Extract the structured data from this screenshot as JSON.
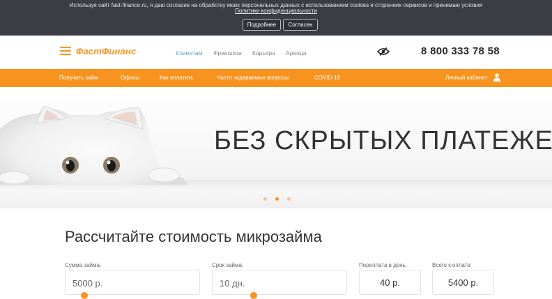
{
  "cookie": {
    "text": "Используя сайт fast-finance.ru, я даю согласие на обработку моих персональных данных с использованием cookies и сторонних сервисов и принимаю условия",
    "link": "Политики конфиденциальности",
    "more_label": "Подробнее",
    "agree_label": "Согласен"
  },
  "header": {
    "logo": "ФастФинанс",
    "nav": [
      "Клиентам",
      "Франшиза",
      "Карьера",
      "Аренда"
    ],
    "phone": "8 800 333 78 58"
  },
  "menu": {
    "items": [
      "Получить займ",
      "Офисы",
      "Как оплатить",
      "Часто задаваемые вопросы",
      "COVID-19"
    ],
    "cabinet": "Личный кабинет"
  },
  "banner": {
    "headline": "БЕЗ СКРЫТЫХ ПЛАТЕЖЕЙ",
    "slides_total": 3,
    "active_slide": 2
  },
  "calculator": {
    "title": "Рассчитайте стоимость микрозайма",
    "amount_label": "Сумма займа:",
    "amount_value": "5000 р.",
    "term_label": "Срок займа:",
    "term_value": "10 дн.",
    "overpay_label": "Переплата в день:",
    "overpay_value": "40 р.",
    "total_label": "Всего к оплате:",
    "total_value": "5400 р."
  },
  "colors": {
    "accent": "#f7931e",
    "cookie_bg": "#3a3d44",
    "link_active": "#5a9fd6"
  }
}
